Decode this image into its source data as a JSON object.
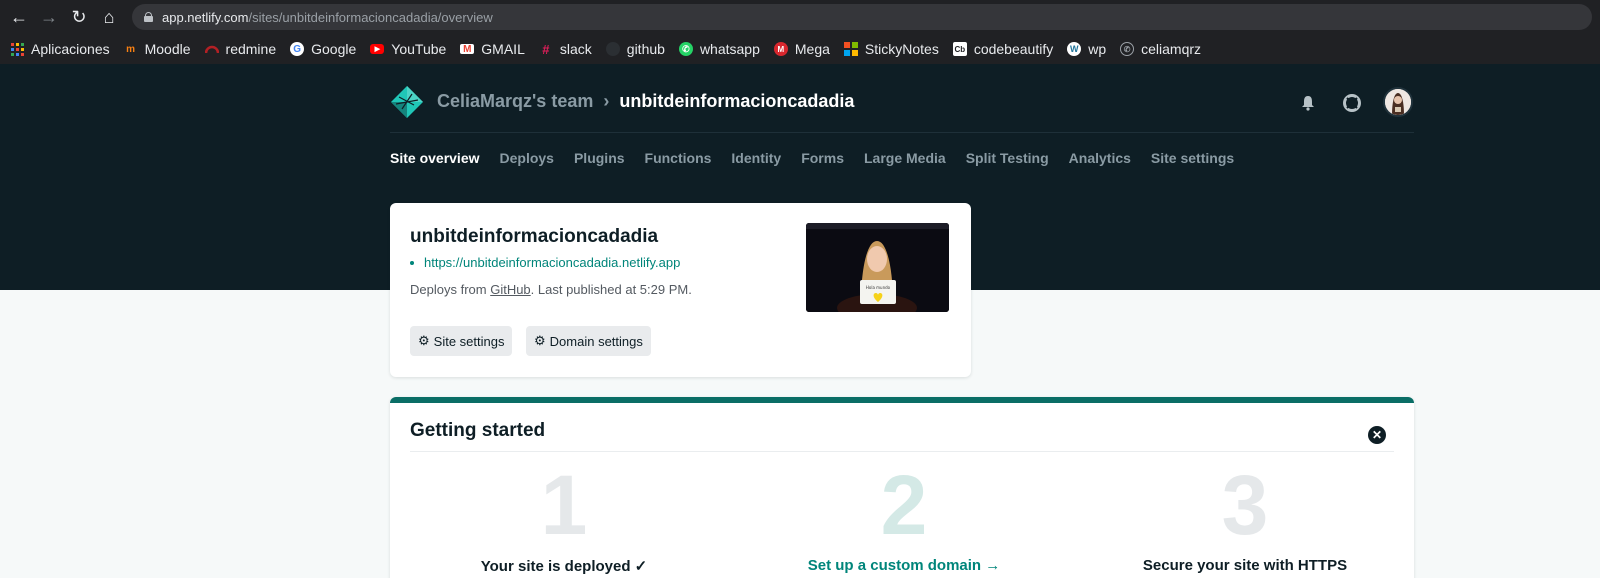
{
  "browser": {
    "url_host": "app.netlify.com",
    "url_path": "/sites/unbitdeinformacioncadadia/overview",
    "bookmarks": [
      {
        "label": "Aplicaciones",
        "icon": "apps-grid-icon",
        "color": "#ea4335"
      },
      {
        "label": "Moodle",
        "icon": "moodle-icon",
        "color": "#f98012"
      },
      {
        "label": "redmine",
        "icon": "redmine-icon",
        "color": "#b32024"
      },
      {
        "label": "Google",
        "icon": "google-icon",
        "color": "#4285f4"
      },
      {
        "label": "YouTube",
        "icon": "youtube-icon",
        "color": "#ff0000"
      },
      {
        "label": "GMAIL",
        "icon": "gmail-icon",
        "color": "#ea4335"
      },
      {
        "label": "slack",
        "icon": "slack-icon",
        "color": "#e01e5a"
      },
      {
        "label": "github",
        "icon": "github-icon",
        "color": "#24292e"
      },
      {
        "label": "whatsapp",
        "icon": "whatsapp-icon",
        "color": "#25d366"
      },
      {
        "label": "Mega",
        "icon": "mega-icon",
        "color": "#d9272e"
      },
      {
        "label": "StickyNotes",
        "icon": "stickynotes-icon",
        "color": "#f25022"
      },
      {
        "label": "codebeautify",
        "icon": "codebeautify-icon",
        "color": "#ffffff"
      },
      {
        "label": "wp",
        "icon": "wordpress-icon",
        "color": "#21759b"
      },
      {
        "label": "celiamqrz",
        "icon": "whatsapp-outline-icon",
        "color": "#9aa0a6"
      }
    ]
  },
  "header": {
    "team": "CeliaMarqz's team",
    "separator": "›",
    "site": "unbitdeinformacioncadadia",
    "tabs": [
      "Site overview",
      "Deploys",
      "Plugins",
      "Functions",
      "Identity",
      "Forms",
      "Large Media",
      "Split Testing",
      "Analytics",
      "Site settings"
    ],
    "active_tab": "Site overview"
  },
  "site_card": {
    "name": "unbitdeinformacioncadadia",
    "url": "https://unbitdeinformacioncadadia.netlify.app",
    "deploy_prefix": "Deploys from ",
    "deploy_source": "GitHub",
    "deploy_suffix": ". Last published at 5:29 PM.",
    "site_settings_label": "Site settings",
    "domain_settings_label": "Domain settings",
    "thumb_sign_text": "Hola mundo"
  },
  "getting_started": {
    "title": "Getting started",
    "steps": [
      {
        "number": "1",
        "label": "Your site is deployed ✓"
      },
      {
        "number": "2",
        "label": "Set up a custom domain →"
      },
      {
        "number": "3",
        "label": "Secure your site with HTTPS"
      }
    ]
  },
  "colors": {
    "header_bg": "#0e1e25",
    "accent_teal": "#00857a",
    "progress_bar": "#0a6e66"
  }
}
